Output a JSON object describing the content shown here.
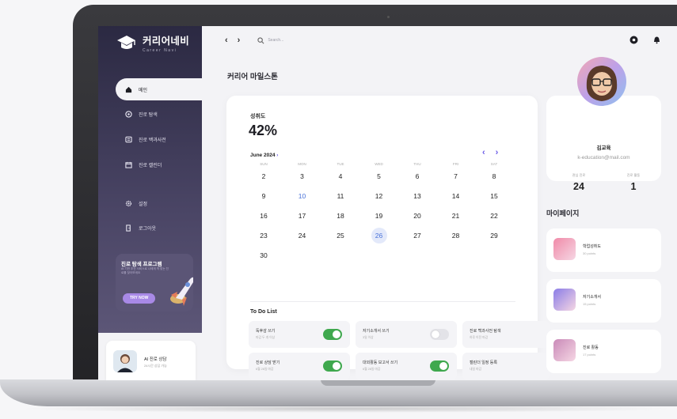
{
  "sidebar": {
    "logo_title": "커리어네비",
    "logo_sub": "Career Navi",
    "items": [
      {
        "label": "메인",
        "icon": "home-icon"
      },
      {
        "label": "진로 탐색",
        "icon": "compass-icon"
      },
      {
        "label": "진로 백과사전",
        "icon": "book-icon"
      },
      {
        "label": "진로 캘린더",
        "icon": "calendar-icon"
      },
      {
        "label": "설정",
        "icon": "gear-icon"
      },
      {
        "label": "로그아웃",
        "icon": "logout-icon"
      }
    ],
    "promo": {
      "title": "진로 탐색 프로그램",
      "desc": "AI 기반 추천 서비스로 나에게 딱 맞는 진로를 찾아보세요",
      "button": "TRY NOW"
    },
    "ai_card": {
      "title": "AI 진로 상담",
      "sub": "24시간 상담 가능"
    }
  },
  "topbar": {
    "back": "‹",
    "forward": "›",
    "search_placeholder": "Search..."
  },
  "page_title": "커리어 마일스톤",
  "achievement": {
    "label": "성취도",
    "value": "42%"
  },
  "calendar": {
    "month": "June 2024",
    "weekdays": [
      "SUN",
      "MON",
      "TUE",
      "WED",
      "THU",
      "FRI",
      "SAT"
    ],
    "weeks": [
      [
        "2",
        "3",
        "4",
        "5",
        "6",
        "7",
        "8"
      ],
      [
        "9",
        "10",
        "11",
        "12",
        "13",
        "14",
        "15"
      ],
      [
        "16",
        "17",
        "18",
        "19",
        "20",
        "21",
        "22"
      ],
      [
        "23",
        "24",
        "25",
        "26",
        "27",
        "28",
        "29"
      ],
      [
        "30"
      ]
    ],
    "highlighted": "10",
    "selected": "26"
  },
  "todo": {
    "title": "To Do List",
    "items": [
      {
        "name": "독후감 쓰기",
        "sub": "마감 두 개 이상",
        "on": true
      },
      {
        "name": "자기소개서 쓰기",
        "sub": "3일 이상",
        "on": false
      },
      {
        "name": "진로 백과사전 탐색",
        "sub": "하루 이전 마감",
        "on": null
      },
      {
        "name": "진로 상담 받기",
        "sub": "6월 28일 마감",
        "on": true
      },
      {
        "name": "대외활동 보고서 쓰기",
        "sub": "6월 28일 마감",
        "on": true
      },
      {
        "name": "캘린더 일정 등록",
        "sub": "내일 마감",
        "on": null
      }
    ]
  },
  "profile": {
    "name": "김교육",
    "email": "k-education@mail.com",
    "stats": [
      {
        "label": "관심 진로",
        "value": "24"
      },
      {
        "label": "진로 활동",
        "value": "1"
      }
    ]
  },
  "mypage": {
    "title": "마이페이지",
    "items": [
      {
        "label": "학업성취도",
        "sub": "30 points",
        "color": "#f08aa8"
      },
      {
        "label": "자기소개서",
        "sub": "15 points",
        "color": "#8a7ce6"
      },
      {
        "label": "진로 활동",
        "sub": "17 points",
        "color": "#c98ab8"
      }
    ]
  },
  "colors": {
    "accent": "#6b5ce7",
    "toggle_on": "#3fa84e",
    "sidebar": "#2b2942"
  }
}
